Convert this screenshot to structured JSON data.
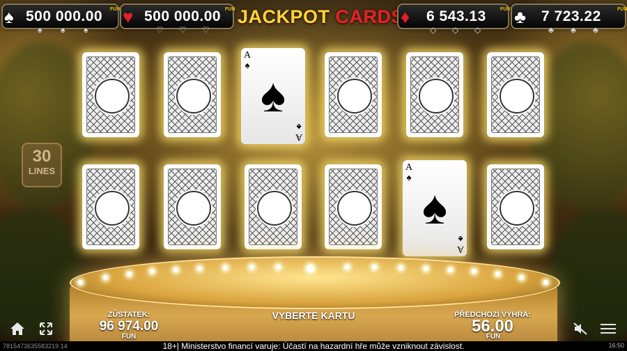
{
  "jackpots": [
    {
      "suit": "spades",
      "symbol": "♠",
      "amount": "500 000.00",
      "badge": "FUN",
      "color": "#ffffff"
    },
    {
      "suit": "hearts",
      "symbol": "♥",
      "amount": "500 000.00",
      "badge": "FUN",
      "color": "#e3202a"
    },
    {
      "suit": "diamonds",
      "symbol": "♦",
      "amount": "6 543.13",
      "badge": "FUN",
      "color": "#e3202a"
    },
    {
      "suit": "clubs",
      "symbol": "♣",
      "amount": "7 723.22",
      "badge": "FUN",
      "color": "#ffffff"
    }
  ],
  "title": {
    "part1": "JACKPOT",
    "part2": "CARDS"
  },
  "lines_badge": {
    "number": "30",
    "label": "LINES"
  },
  "cards": {
    "rows": [
      [
        "back",
        "back",
        "ace-spades",
        "back",
        "back",
        "back"
      ],
      [
        "back",
        "back",
        "back",
        "back",
        "ace-spades",
        "back"
      ]
    ],
    "revealed_rank": "A",
    "revealed_suit": "♠"
  },
  "hud": {
    "balance_label": "ZŮSTATEK:",
    "balance_value": "96 974.00",
    "balance_currency": "FUN",
    "prompt": "VYBERTE KARTU",
    "last_win_label": "PŘEDCHOZÍ VÝHRA:",
    "last_win_value": "56.00",
    "last_win_currency": "FUN"
  },
  "footer": {
    "session_id": "7815473635583219 14",
    "disclaimer": "18+| Ministerstvo financí varuje: Účastí na hazardní hře může vzniknout závislost.",
    "clock": "16:50"
  },
  "icons": [
    "home-icon",
    "fullscreen-icon",
    "mute-icon",
    "menu-icon"
  ],
  "colors": {
    "accent_gold": "#ffd23a",
    "title_red": "#e8202a",
    "fun_yellow": "#f2c200"
  }
}
